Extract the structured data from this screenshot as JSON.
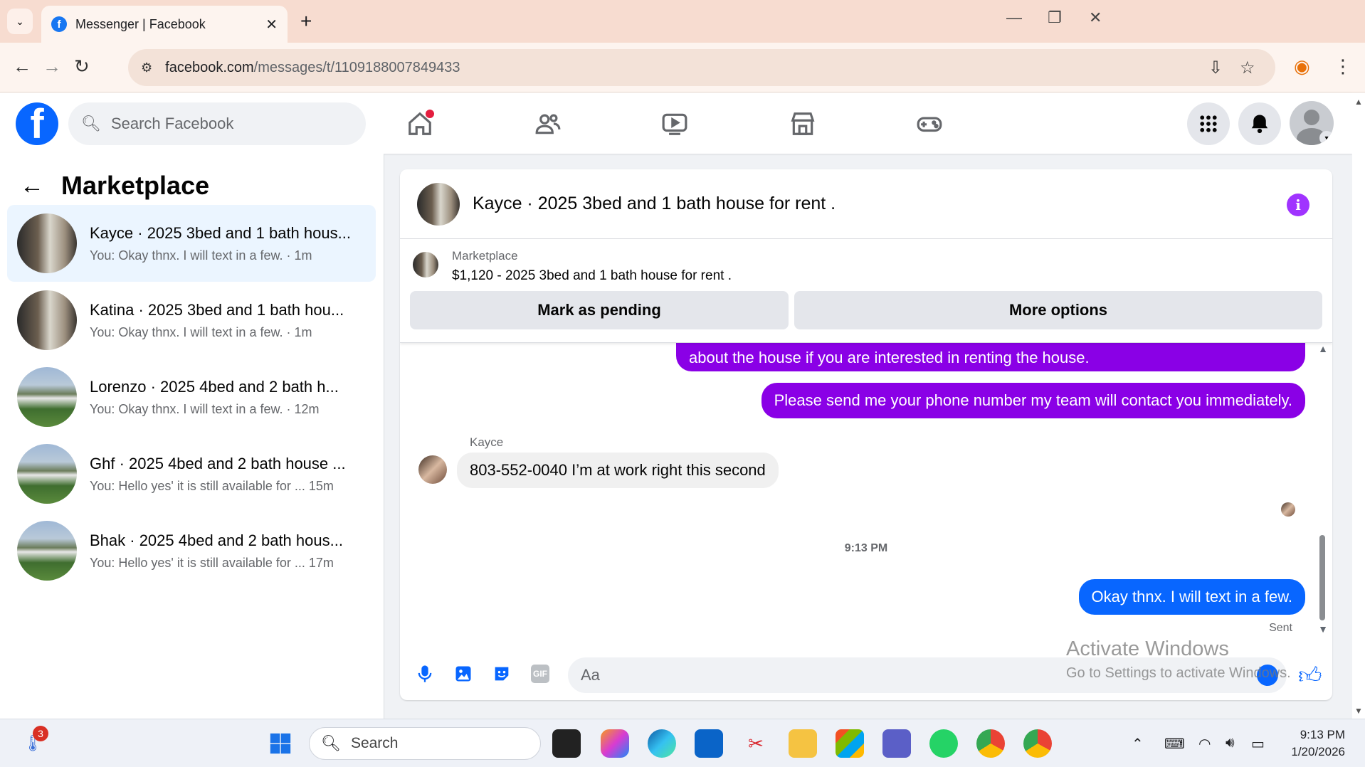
{
  "browser": {
    "tab_title": "Messenger | Facebook",
    "url_host": "facebook.com",
    "url_path": "/messages/t/1109188007849433"
  },
  "fb_header": {
    "search_placeholder": "Search Facebook"
  },
  "left_panel": {
    "title": "Marketplace",
    "conversations": [
      {
        "name": "Kayce · 2025 3bed and 1 bath hous...",
        "preview": "You: Okay thnx. I will text in a few. · 1m",
        "active": true
      },
      {
        "name": "Katina · 2025 3bed and 1 bath hou...",
        "preview": "You: Okay thnx. I will text in a few. · 1m",
        "active": false
      },
      {
        "name": "Lorenzo · 2025 4bed and 2 bath h...",
        "preview": "You: Okay thnx. I will text in a few. · 12m",
        "active": false
      },
      {
        "name": "Ghf · 2025 4bed and 2 bath house ...",
        "preview": "You: Hello yes' it is still available for ...  15m",
        "active": false
      },
      {
        "name": "Bhak · 2025 4bed and 2 bath hous...",
        "preview": "You: Hello yes' it is still available for ...  17m",
        "active": false
      }
    ]
  },
  "chat": {
    "title": "Kayce · 2025 3bed and 1 bath house for rent .",
    "marketplace_label": "Marketplace",
    "listing": "$1,120 - 2025 3bed and 1 bath house for rent .",
    "mark_pending_label": "Mark as pending",
    "more_options_label": "More options",
    "messages": {
      "out1": "about the house if you are interested in renting the house.",
      "out2": "Please send me your phone number my team will contact you immediately.",
      "sender": "Kayce",
      "in1": "803-552-0040 I’m at work right this second",
      "timestamp": "9:13 PM",
      "out3": "Okay thnx. I will text in a few.",
      "status": "Sent"
    },
    "composer_placeholder": "Aa",
    "gif_label": "GIF"
  },
  "watermark": {
    "line1": "Activate Windows",
    "line2": "Go to Settings to activate Windows."
  },
  "taskbar": {
    "search_label": "Search",
    "notification_count": "3",
    "time": "9:13 PM",
    "date": "1/20/2026"
  },
  "colors": {
    "fb_blue": "#0866ff",
    "outgoing_purple": "#8a00e6",
    "active_conv_bg": "#ebf5ff"
  }
}
